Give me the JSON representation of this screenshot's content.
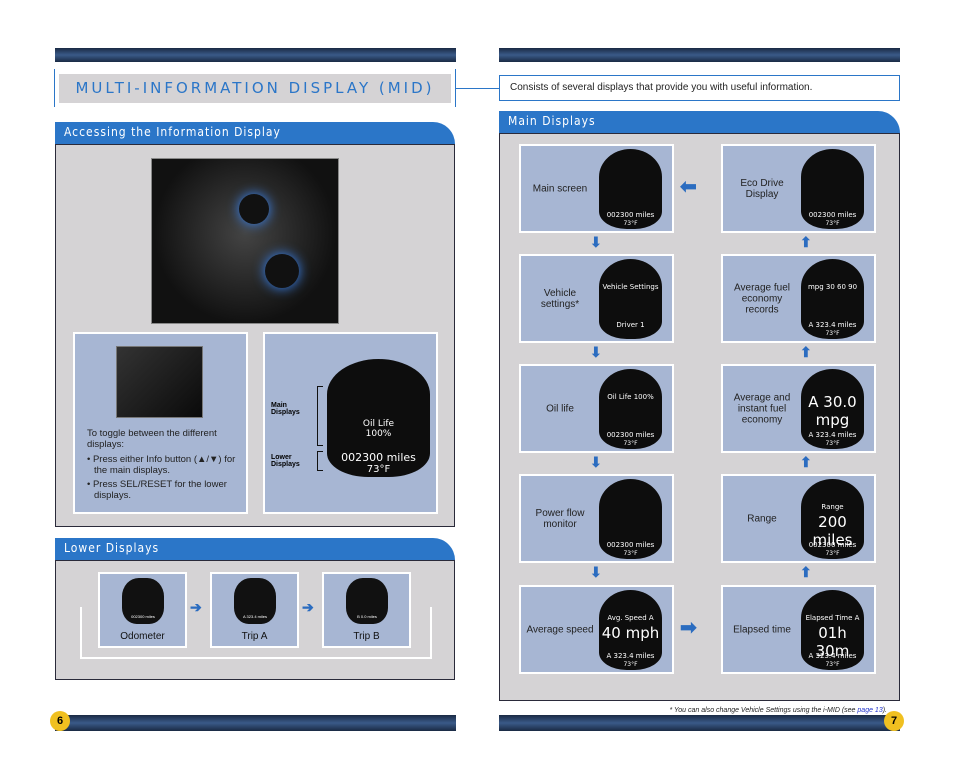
{
  "title": "MULTI-INFORMATION DISPLAY (MID)",
  "description": "Consists of several displays that provide you with useful information.",
  "accessing": {
    "header": "Accessing the Information Display",
    "instructions": "To toggle between the different displays:",
    "bullets": [
      "• Press either Info button (▲/▼) for the main displays.",
      "• Press SEL/RESET for the lower displays."
    ],
    "main_label": "Main Displays",
    "lower_label": "Lower Displays",
    "screen": {
      "text": "Oil Life",
      "value": "100%",
      "odo": "002300 miles",
      "temp": "73°F"
    }
  },
  "lower": {
    "header": "Lower Displays",
    "items": [
      {
        "label": "Odometer",
        "screen": "002300 miles"
      },
      {
        "label": "Trip A",
        "screen": "A 323.4 miles"
      },
      {
        "label": "Trip B",
        "screen": "B 0.0 miles"
      }
    ]
  },
  "main": {
    "header": "Main Displays",
    "left": [
      {
        "label": "Main screen",
        "text": "",
        "big": "",
        "odo": "002300 miles",
        "temp": "73°F"
      },
      {
        "label": "Vehicle settings*",
        "text": "Vehicle Settings",
        "big": "",
        "odo": "Driver 1",
        "temp": ""
      },
      {
        "label": "Oil life",
        "text": "Oil Life 100%",
        "big": "",
        "odo": "002300 miles",
        "temp": "73°F"
      },
      {
        "label": "Power flow monitor",
        "text": "",
        "big": "",
        "odo": "002300 miles",
        "temp": "73°F"
      },
      {
        "label": "Average speed",
        "text": "Avg. Speed A",
        "big": "40 mph",
        "odo": "A 323.4 miles",
        "temp": "73°F"
      }
    ],
    "right": [
      {
        "label": "Eco Drive Display",
        "text": "",
        "big": "",
        "odo": "002300 miles",
        "temp": "73°F"
      },
      {
        "label": "Average fuel economy records",
        "text": "mpg 30 60 90",
        "big": "",
        "odo": "A 323.4 miles",
        "temp": "73°F"
      },
      {
        "label": "Average and instant fuel economy",
        "text": "",
        "big": "A 30.0 mpg",
        "odo": "A 323.4 miles",
        "temp": "73°F"
      },
      {
        "label": "Range",
        "text": "Range",
        "big": "200 miles",
        "odo": "002300 miles",
        "temp": "73°F"
      },
      {
        "label": "Elapsed time",
        "text": "Elapsed Time A",
        "big": "01h 30m",
        "odo": "A 323.4 miles",
        "temp": "73°F"
      }
    ]
  },
  "footnote": "* You can also change Vehicle Settings using the i-MID (see ",
  "footnote_link": "page 13",
  "footnote_end": ").",
  "pages": {
    "left": "6",
    "right": "7"
  },
  "colors": {
    "accent": "#2b76c8",
    "panel": "#a7b6d3",
    "section": "#d5d3d5"
  }
}
